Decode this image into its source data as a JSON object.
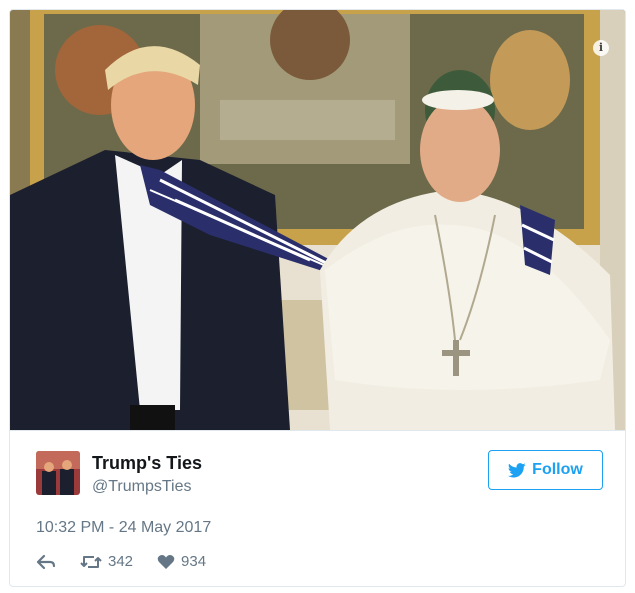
{
  "tweet": {
    "display_name": "Trump's Ties",
    "handle": "@TrumpsTies",
    "follow_label": "Follow",
    "timestamp": "10:32 PM - 24 May 2017",
    "retweets": "342",
    "likes": "934"
  },
  "icons": {
    "info": "info-icon",
    "follow": "twitter-bird-icon",
    "reply": "reply-icon",
    "retweet": "retweet-icon",
    "like": "heart-icon"
  },
  "colors": {
    "accent": "#1da1f2",
    "secondary_text": "#657786",
    "primary_text": "#14171a",
    "border": "#e1e8ed"
  }
}
